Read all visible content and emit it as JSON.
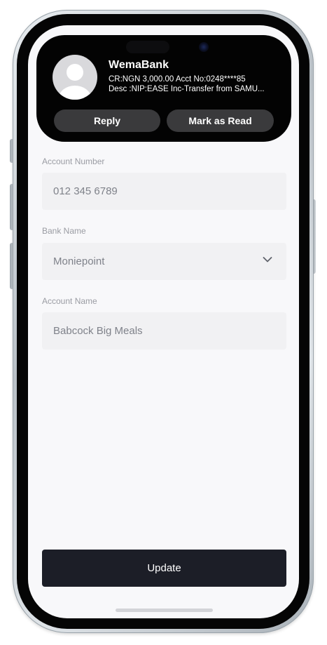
{
  "notification": {
    "sender": "WemaBank",
    "line1": "CR:NGN 3,000.00 Acct No:0248****85",
    "line2": "Desc :NIP:EASE Inc-Transfer from SAMU...",
    "reply_label": "Reply",
    "mark_read_label": "Mark as Read",
    "avatar_icon": "person-avatar-icon"
  },
  "form": {
    "account_number": {
      "label": "Account Number",
      "value": "012 345 6789"
    },
    "bank_name": {
      "label": "Bank Name",
      "value": "Moniepoint",
      "icon": "chevron-down-icon"
    },
    "account_name": {
      "label": "Account Name",
      "value": "Babcock Big Meals"
    }
  },
  "update_label": "Update",
  "colors": {
    "screen_bg": "#f8f8fa",
    "field_bg": "#f1f1f3",
    "primary_button": "#1c1e27",
    "notification_bg": "#030303",
    "notification_button": "#3a3a3c"
  }
}
